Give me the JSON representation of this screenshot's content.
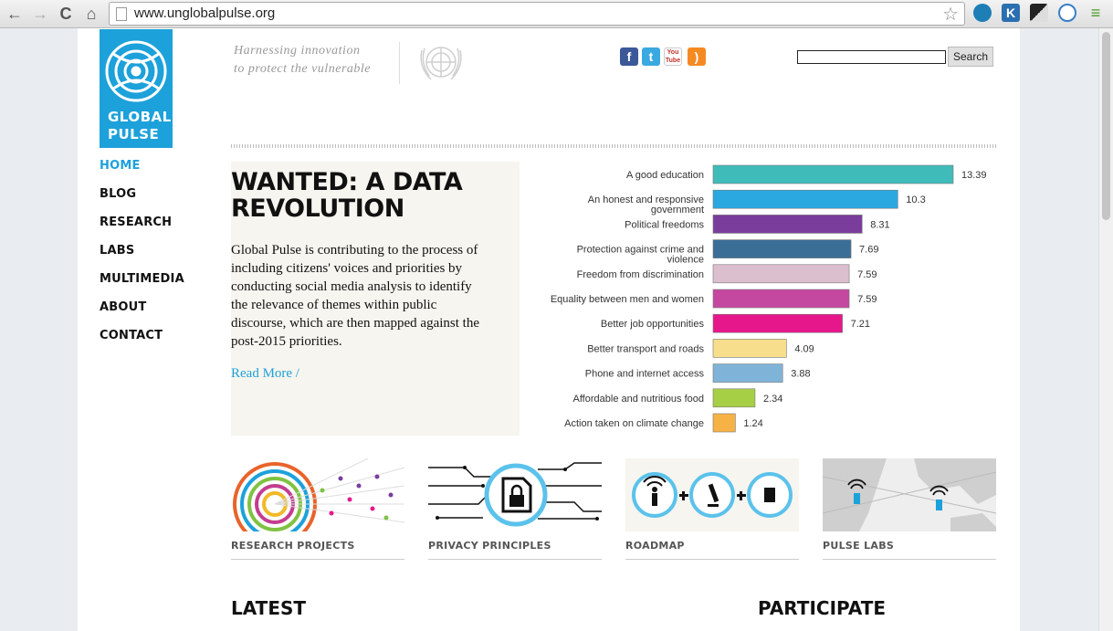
{
  "browser": {
    "url": "www.unglobalpulse.org",
    "back_glyph": "←",
    "forward_glyph": "→",
    "reload_glyph": "C",
    "home_glyph": "⌂",
    "star_glyph": "☆",
    "menu_glyph": "≡",
    "ext_k": "K"
  },
  "header": {
    "logo_line1": "GLOBAL",
    "logo_line2": "PULSE",
    "tagline_line1": "Harnessing innovation",
    "tagline_line2": "to protect the vulnerable",
    "social": [
      "facebook-icon",
      "twitter-icon",
      "youtube-icon",
      "rss-icon"
    ],
    "social_glyphs": {
      "facebook": "f",
      "twitter": "t",
      "youtube": "You Tube",
      "rss": ")"
    },
    "search_button": "Search",
    "search_value": ""
  },
  "nav": {
    "items": [
      "HOME",
      "BLOG",
      "RESEARCH",
      "LABS",
      "MULTIMEDIA",
      "ABOUT",
      "CONTACT"
    ],
    "active": "HOME"
  },
  "feature": {
    "title": "WANTED: A DATA REVOLUTION",
    "body": "Global Pulse is contributing to the process of including citizens' voices and priorities by conducting social media analysis to identify the relevance of themes within public discourse, which are then mapped against the post-2015 priorities.",
    "read_more": "Read More /"
  },
  "chart_data": {
    "type": "bar",
    "orientation": "horizontal",
    "categories": [
      [
        "A good education"
      ],
      [
        "An honest and responsive",
        "government"
      ],
      [
        "Political freedoms"
      ],
      [
        "Protection against crime and",
        "violence"
      ],
      [
        "Freedom from discrimination"
      ],
      [
        "Equality between men and women"
      ],
      [
        "Better job opportunities"
      ],
      [
        "Better transport and roads"
      ],
      [
        "Phone and internet access"
      ],
      [
        "Affordable and nutritious food"
      ],
      [
        "Action taken on climate change"
      ]
    ],
    "values": [
      13.39,
      10.3,
      8.31,
      7.69,
      7.59,
      7.59,
      7.21,
      4.09,
      3.88,
      2.34,
      1.24
    ],
    "value_labels": [
      "13.39",
      "10.3",
      "8.31",
      "7.69",
      "7.59",
      "7.59",
      "7.21",
      "4.09",
      "3.88",
      "2.34",
      "1.24"
    ],
    "colors": [
      "#3fbcba",
      "#2ba8e0",
      "#7a3d9c",
      "#3b6e96",
      "#dcbfcf",
      "#c4489f",
      "#e6178b",
      "#f7de8c",
      "#7fb4d8",
      "#a7cf45",
      "#f7b246"
    ],
    "xlim": [
      0,
      14
    ],
    "title": "",
    "xlabel": "",
    "ylabel": ""
  },
  "tiles": [
    {
      "name": "research-projects",
      "caption": "RESEARCH PROJECTS"
    },
    {
      "name": "privacy-principles",
      "caption": "PRIVACY PRINCIPLES"
    },
    {
      "name": "roadmap",
      "caption": "ROADMAP"
    },
    {
      "name": "pulse-labs",
      "caption": "PULSE LABS"
    }
  ],
  "sections": {
    "latest": "LATEST",
    "participate": "PARTICIPATE"
  },
  "colors": {
    "brand_blue": "#1da1da",
    "feature_bg": "#f7f5ef"
  }
}
